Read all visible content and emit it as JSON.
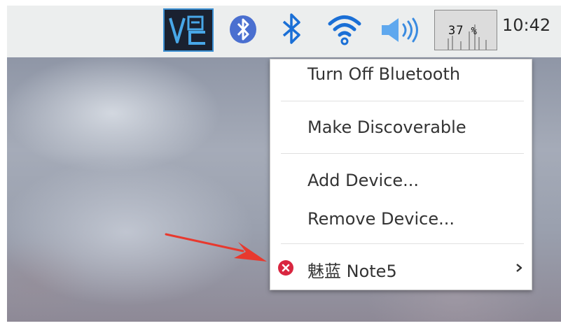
{
  "taskbar": {
    "tray_icons": [
      "vnc-icon",
      "bluetooth-round-icon",
      "bluetooth-icon",
      "wifi-icon",
      "volume-icon"
    ],
    "cpu_monitor": {
      "value": "37",
      "unit": "%"
    },
    "clock": "10:42"
  },
  "bluetooth_menu": {
    "items": [
      {
        "label": "Turn Off Bluetooth"
      },
      {
        "label": "Make Discoverable"
      },
      {
        "label": "Add Device..."
      },
      {
        "label": "Remove Device..."
      }
    ],
    "device": {
      "name": "魅蓝 Note5",
      "status_icon": "disconnected-icon",
      "submenu_icon": "chevron-right-icon"
    }
  },
  "annotation": {
    "arrow_color": "#e8392e"
  },
  "colors": {
    "taskbar_bg": "#eceeee",
    "bluetooth_blue": "#1a6fd6",
    "vnc_bg": "#1a2130",
    "status_red": "#d92640"
  }
}
